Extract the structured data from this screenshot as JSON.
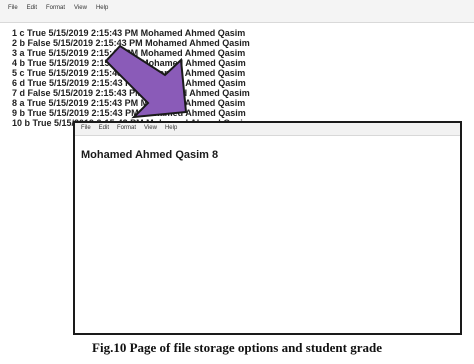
{
  "background_window": {
    "menu": [
      "File",
      "Edit",
      "Format",
      "View",
      "Help"
    ],
    "lines": [
      "1 c True 5/15/2019 2:15:43 PM Mohamed Ahmed Qasim",
      "2 b False 5/15/2019 2:15:43 PM Mohamed Ahmed Qasim",
      "3 a True 5/15/2019 2:15:43 PM Mohamed Ahmed Qasim",
      "4 b True 5/15/2019 2:15:43 PM Mohamed Ahmed Qasim",
      "5 c True 5/15/2019 2:15:43 PM Mohamed Ahmed Qasim",
      "6 d True 5/15/2019 2:15:43 PM Mohamed Ahmed Qasim",
      "7 d False 5/15/2019 2:15:43 PM Mohamed Ahmed Qasim",
      "8 a True 5/15/2019 2:15:43 PM Mohamed Ahmed Qasim",
      "9 b True 5/15/2019 2:15:43 PM Mohamed Ahmed Qasim",
      "10 b True 5/15/2019 2:15:43 PM Mohamed Ahmed Qasim"
    ]
  },
  "foreground_window": {
    "menu": [
      "File",
      "Edit",
      "Format",
      "View",
      "Help"
    ],
    "content": "Mohamed Ahmed Qasim 8"
  },
  "arrow": {
    "color": "#8a5bb8",
    "outline": "#1a1a1a"
  },
  "caption": "Fig.10 Page of file storage options and student grade"
}
